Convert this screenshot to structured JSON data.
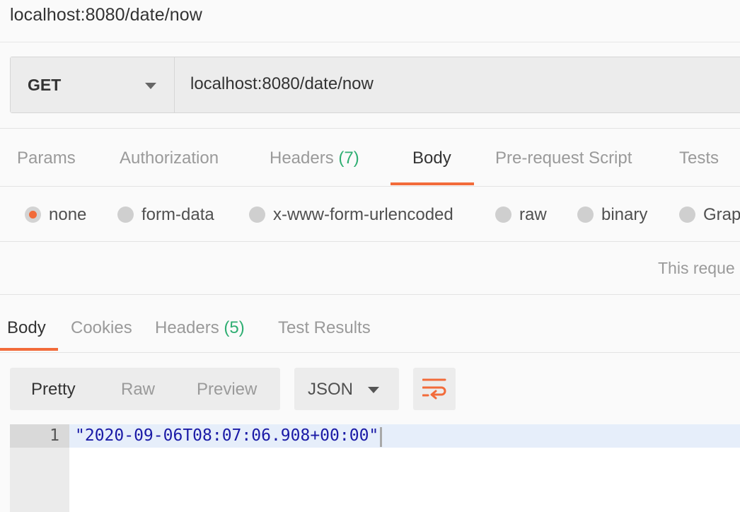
{
  "window": {
    "title": "localhost:8080/date/now"
  },
  "request": {
    "method": "GET",
    "url": "localhost:8080/date/now"
  },
  "request_tabs": {
    "params": "Params",
    "authorization": "Authorization",
    "headers": "Headers",
    "headers_count": "(7)",
    "body": "Body",
    "pre_request": "Pre-request Script",
    "tests": "Tests",
    "active": "Body"
  },
  "body_types": {
    "none": "none",
    "form_data": "form-data",
    "urlencoded": "x-www-form-urlencoded",
    "raw": "raw",
    "binary": "binary",
    "graphql": "Grap",
    "selected": "none",
    "note": "This reque"
  },
  "response_tabs": {
    "body": "Body",
    "cookies": "Cookies",
    "headers": "Headers",
    "headers_count": "(5)",
    "test_results": "Test Results",
    "active": "Body"
  },
  "response_toolbar": {
    "pretty": "Pretty",
    "raw": "Raw",
    "preview": "Preview",
    "active_view": "Pretty",
    "format": "JSON",
    "wrap_icon": "wrap-lines-icon"
  },
  "response_body": {
    "line_number": "1",
    "content": "\"2020-09-06T08:07:06.908+00:00\""
  },
  "colors": {
    "accent": "#f26b3a",
    "count": "#2fae72",
    "string": "#1a1aa6"
  }
}
